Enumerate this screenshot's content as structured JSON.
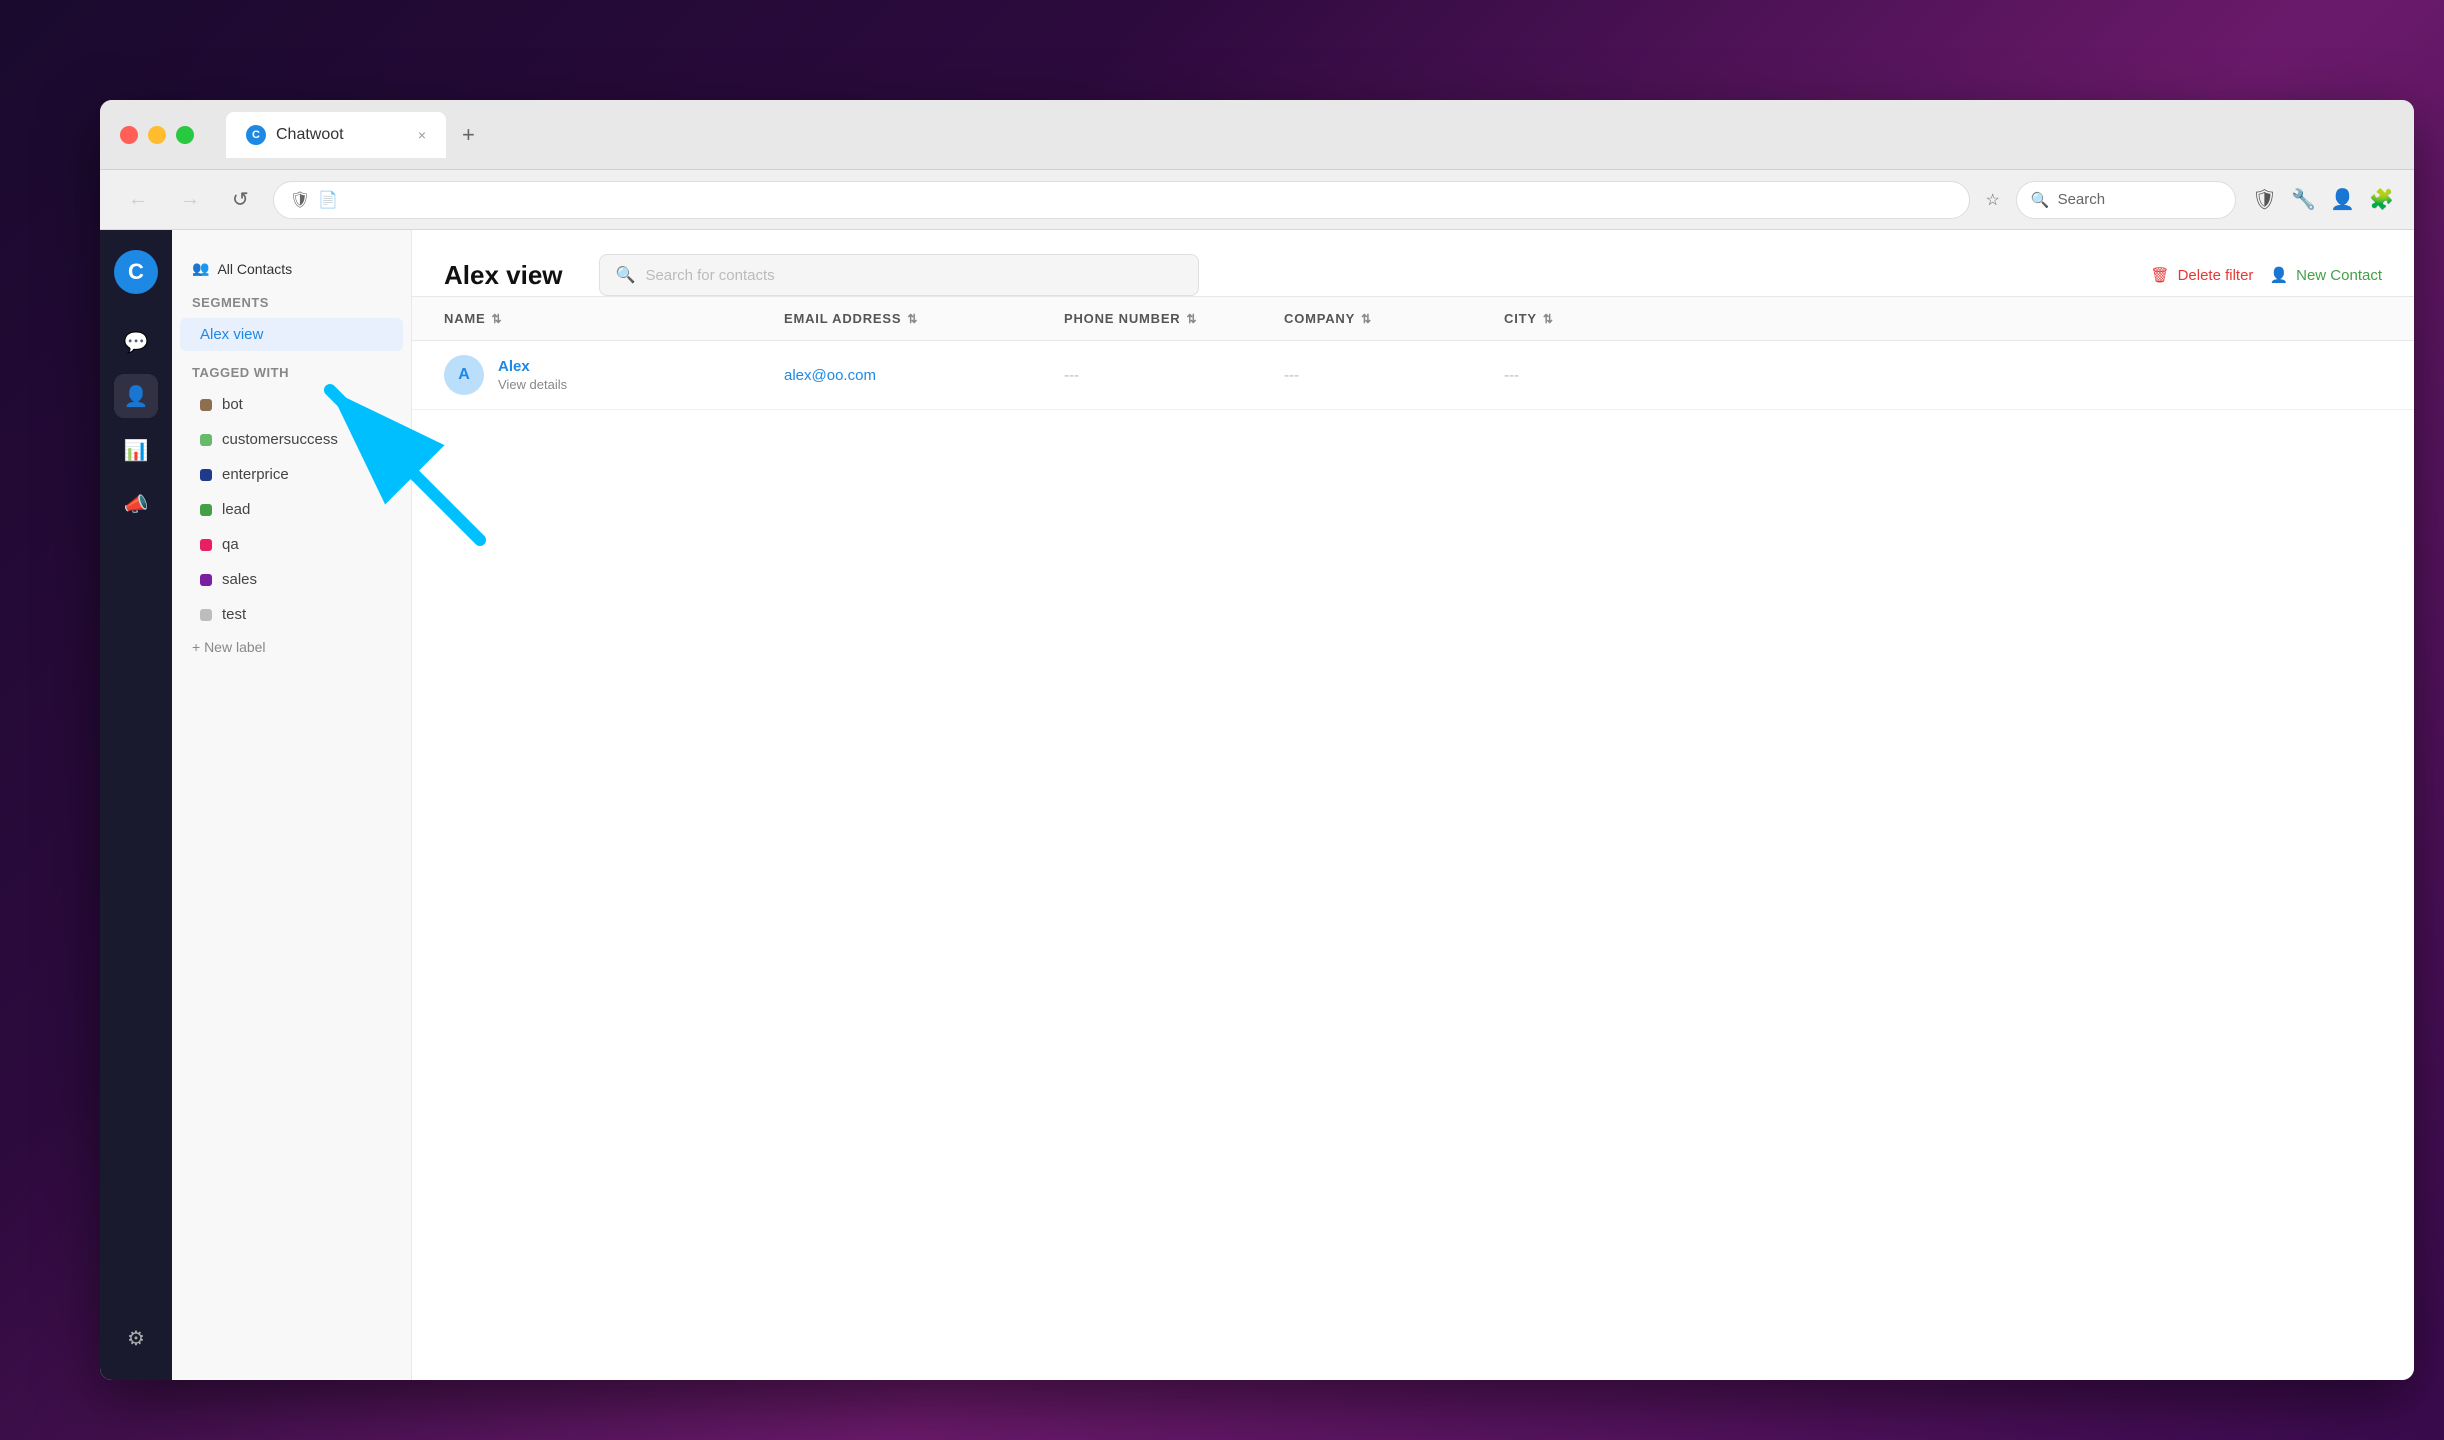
{
  "browser": {
    "tab_title": "Chatwoot",
    "tab_favicon": "C",
    "close_label": "×",
    "new_tab_label": "+",
    "nav_back": "←",
    "nav_forward": "→",
    "nav_refresh": "↺",
    "url_shield": "🛡",
    "url_doc": "📄",
    "url_star": "☆",
    "search_placeholder": "Search",
    "search_icon": "🔍"
  },
  "sidebar": {
    "logo_letter": "C",
    "icons": [
      {
        "name": "chat-icon",
        "symbol": "💬"
      },
      {
        "name": "contacts-icon",
        "symbol": "👤"
      },
      {
        "name": "reports-icon",
        "symbol": "📊"
      },
      {
        "name": "campaigns-icon",
        "symbol": "📣"
      },
      {
        "name": "settings-icon",
        "symbol": "⚙"
      }
    ]
  },
  "nav": {
    "all_contacts_label": "All Contacts",
    "all_contacts_icon": "👥",
    "segments_title": "Segments",
    "segments": [
      {
        "label": "Alex view",
        "active": true
      }
    ],
    "tagged_with_title": "Tagged with",
    "labels": [
      {
        "label": "bot",
        "color": "#8B6F4E"
      },
      {
        "label": "customersuccess",
        "color": "#66BB6A"
      },
      {
        "label": "enterprice",
        "color": "#1E3A8A"
      },
      {
        "label": "lead",
        "color": "#43A047"
      },
      {
        "label": "qa",
        "color": "#E91E63"
      },
      {
        "label": "sales",
        "color": "#7B1FA2"
      },
      {
        "label": "test",
        "color": "#BDBDBD"
      }
    ],
    "new_label": "+ New label"
  },
  "main": {
    "page_title": "Alex view",
    "search_placeholder": "Search for contacts",
    "delete_filter_label": "Delete filter",
    "new_contact_label": "New Contact",
    "table": {
      "columns": [
        {
          "label": "NAME",
          "sort": true
        },
        {
          "label": "EMAIL ADDRESS",
          "sort": true
        },
        {
          "label": "PHONE NUMBER",
          "sort": true
        },
        {
          "label": "COMPANY",
          "sort": true
        },
        {
          "label": "CITY",
          "sort": true
        }
      ],
      "rows": [
        {
          "avatar": "A",
          "name": "Alex",
          "subtext": "View details",
          "email": "alex@oo.com",
          "phone": "---",
          "company": "---",
          "city": "---"
        }
      ]
    }
  },
  "colors": {
    "accent_blue": "#1e88e5",
    "delete_red": "#e53935",
    "new_green": "#43a047",
    "arrow_cyan": "#00bcd4"
  }
}
